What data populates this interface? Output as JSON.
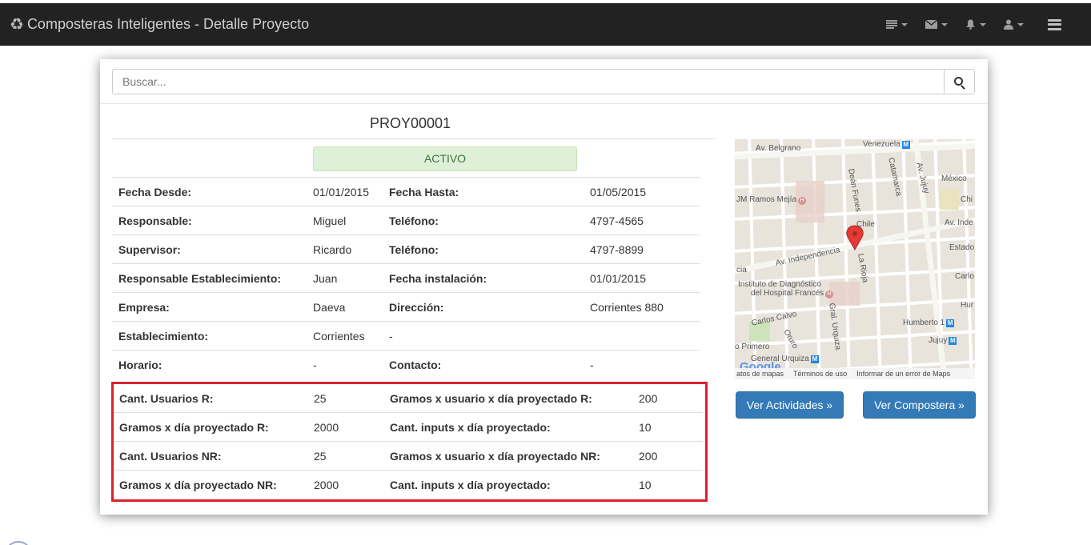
{
  "navbar": {
    "brand_icon": "recycle-icon",
    "title": "Composteras Inteligentes - Detalle Proyecto",
    "icons": [
      "tasks-icon",
      "envelope-icon",
      "bell-icon",
      "user-icon",
      "menu-icon"
    ]
  },
  "search": {
    "placeholder": "Buscar...",
    "button_icon": "search-icon"
  },
  "project": {
    "code": "PROY00001",
    "status": "ACTIVO"
  },
  "details": [
    {
      "label1": "Fecha Desde:",
      "value1": "01/01/2015",
      "label2": "Fecha Hasta:",
      "value2": "01/05/2015"
    },
    {
      "label1": "Responsable:",
      "value1": "Miguel",
      "label2": "Teléfono:",
      "value2": "4797-4565"
    },
    {
      "label1": "Supervisor:",
      "value1": "Ricardo",
      "label2": "Teléfono:",
      "value2": "4797-8899"
    },
    {
      "label1": "Responsable Establecimiento:",
      "value1": "Juan",
      "label2": "Fecha instalación:",
      "value2": "01/01/2015"
    },
    {
      "label1": "Empresa:",
      "value1": "Daeva",
      "label2": "Dirección:",
      "value2": "Corrientes 880"
    },
    {
      "label1": "Establecimiento:",
      "value1": "Corrientes",
      "label2": "-",
      "value2": ""
    },
    {
      "label1": "Horario:",
      "value1": "-",
      "label2": "Contacto:",
      "value2": "-"
    }
  ],
  "projections": [
    {
      "label1": "Cant. Usuarios R:",
      "value1": "25",
      "label2": "Gramos x usuario x día proyectado R:",
      "value2": "200"
    },
    {
      "label1": "Gramos x día proyectado R:",
      "value1": "2000",
      "label2": "Cant. inputs x día proyectado:",
      "value2": "10"
    },
    {
      "label1": "Cant. Usuarios NR:",
      "value1": "25",
      "label2": "Gramos x usuario x día proyectado NR:",
      "value2": "200"
    },
    {
      "label1": "Gramos x día proyectado NR:",
      "value1": "2000",
      "label2": "Cant. inputs x día proyectado:",
      "value2": "10"
    }
  ],
  "map": {
    "labels": {
      "belgrano": "Av. Belgrano",
      "venezuela": "Venezuela",
      "dean_funes": "Deán Funes",
      "catamarca": "Catamarca",
      "jujuy_av": "Av. Jujuy",
      "mexico": "México",
      "ramos_mejia": "JM Ramos Mejía",
      "chile": "Chile",
      "chi": "Chi",
      "av_inde": "Av. Inde",
      "estado": "Estado",
      "av_independencia": "Av. Independencia",
      "cia": "cia",
      "la_rioja": "La Rioja",
      "carlo": "Carlo",
      "instituto_1": "Instituto de Diagnóstico",
      "instituto_2": "del Hospital Francés",
      "hur": "Hur",
      "carlos_calvo": "Carlos Calvo",
      "gral_urquiza": "Gral. Urquiza",
      "humberto": "Humberto 1",
      "oruro": "Oruro",
      "primero": "o Primero",
      "jujuy": "Jujuy",
      "general_urquiza": "General Urquiza",
      "google": "Google"
    },
    "footer": [
      "atos de mapas",
      "Términos de uso",
      "Informar de un error de Maps"
    ],
    "metro_letter": "M",
    "hospital_letter": "H"
  },
  "buttons": {
    "activities": "Ver Actividades »",
    "composter": "Ver Compostera »"
  }
}
